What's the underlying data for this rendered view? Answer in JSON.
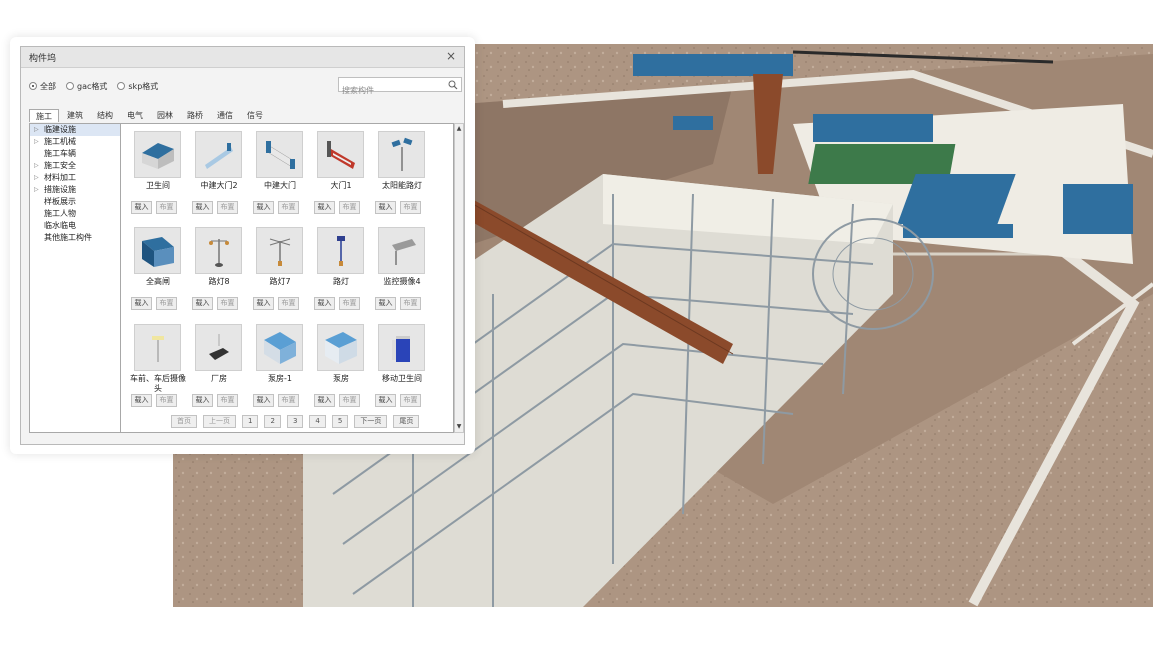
{
  "dialog": {
    "title": "构件坞",
    "close_glyph": "×"
  },
  "filters": [
    {
      "label": "全部",
      "selected": true
    },
    {
      "label": "gac格式",
      "selected": false
    },
    {
      "label": "skp格式",
      "selected": false
    }
  ],
  "search": {
    "placeholder": "搜索构件",
    "value": ""
  },
  "tabs": [
    {
      "label": "施工",
      "active": true
    },
    {
      "label": "建筑",
      "active": false
    },
    {
      "label": "结构",
      "active": false
    },
    {
      "label": "电气",
      "active": false
    },
    {
      "label": "园林",
      "active": false
    },
    {
      "label": "路桥",
      "active": false
    },
    {
      "label": "通信",
      "active": false
    },
    {
      "label": "信号",
      "active": false
    }
  ],
  "tree": [
    {
      "label": "临建设施",
      "expandable": true,
      "selected": true
    },
    {
      "label": "施工机械",
      "expandable": true,
      "selected": false
    },
    {
      "label": "施工车辆",
      "expandable": false,
      "selected": false
    },
    {
      "label": "施工安全",
      "expandable": true,
      "selected": false
    },
    {
      "label": "材料加工",
      "expandable": true,
      "selected": false
    },
    {
      "label": "措施设施",
      "expandable": true,
      "selected": false
    },
    {
      "label": "样板展示",
      "expandable": false,
      "selected": false
    },
    {
      "label": "施工人物",
      "expandable": false,
      "selected": false
    },
    {
      "label": "临水临电",
      "expandable": false,
      "selected": false
    },
    {
      "label": "其他施工构件",
      "expandable": false,
      "selected": false
    }
  ],
  "components": [
    {
      "name": "卫生间",
      "icon": "toilet-house-icon"
    },
    {
      "name": "中建大门2",
      "icon": "gate-2-icon"
    },
    {
      "name": "中建大门",
      "icon": "gate-icon"
    },
    {
      "name": "大门1",
      "icon": "gate-1-icon"
    },
    {
      "name": "太阳能路灯",
      "icon": "solar-streetlight-icon"
    },
    {
      "name": "全高闸",
      "icon": "turnstile-icon"
    },
    {
      "name": "路灯8",
      "icon": "streetlight-8-icon"
    },
    {
      "name": "路灯7",
      "icon": "streetlight-7-icon"
    },
    {
      "name": "路灯",
      "icon": "streetlight-icon"
    },
    {
      "name": "监控摄像4",
      "icon": "camera-icon"
    },
    {
      "name": "车前、车后摄像头",
      "icon": "vehicle-camera-icon"
    },
    {
      "name": "厂房",
      "icon": "factory-icon"
    },
    {
      "name": "泵房-1",
      "icon": "pump-room-1-icon"
    },
    {
      "name": "泵房",
      "icon": "pump-room-icon"
    },
    {
      "name": "移动卫生间",
      "icon": "mobile-toilet-icon"
    }
  ],
  "actions": {
    "load": "载入",
    "place": "布置"
  },
  "pager": [
    "首页",
    "上一页",
    "1",
    "2",
    "3",
    "4",
    "5",
    "下一页",
    "尾页"
  ],
  "colors": {
    "steel_blue": "#2f6f9f",
    "crane_rust": "#8b4a2b",
    "ground_tan": "#b29a84",
    "concrete": "#dedcd4",
    "court_green": "#3d7a4a"
  }
}
